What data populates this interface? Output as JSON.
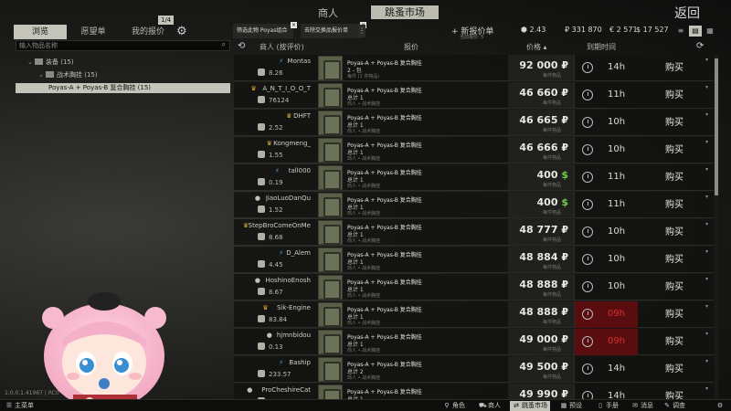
{
  "header": {
    "tab_trader": "商人",
    "tab_flea": "跳蚤市场",
    "back": "返回"
  },
  "left_panel": {
    "tabs": {
      "browse": "浏览",
      "wishlist": "愿望单",
      "my_offers": "我的报价",
      "offer_count": "1/4"
    },
    "search_placeholder": "输入物品名称",
    "tree": {
      "gear": "装备 (15)",
      "rig": "战术胸挂 (15)",
      "item": "Poyas-A + Poyas-B 复合胸挂 (15)"
    }
  },
  "filters": {
    "chip1": "筛选此物 Poyas组合",
    "chip2": "去除交换品报价单",
    "add_offer": "+ 新报价单",
    "add_offer_sub": "当前报价: 5"
  },
  "currencies": {
    "gp": "2.43",
    "rub": "331 870",
    "eur": "2 571",
    "usd": "17 527",
    "gp_symbol": "⬢",
    "rub_symbol": "₽",
    "eur_symbol": "€",
    "usd_symbol": "$"
  },
  "table": {
    "headers": {
      "merchant": "商人 (按评价)",
      "offer": "报价",
      "price": "价格 ▴",
      "expires": "到期时间"
    },
    "rows": [
      {
        "seller": "Montas",
        "badge": "lightning",
        "rating": "8.26",
        "title": "Poyas-A + Poyas-B 复合胸挂",
        "qty": "2 - 包",
        "sub": "每件 (1 件物品)",
        "price": "92 000",
        "currency": "₽",
        "price_sub": "每件物品",
        "expires": "14h",
        "urgent": false,
        "buy": "购买"
      },
      {
        "seller": "A_N_T_I_O_O_T",
        "badge": "crown",
        "rating": "76124",
        "title": "Poyas-A + Poyas-B 复合胸挂",
        "qty": "总计 1",
        "sub": "商人 • 战术胸挂",
        "price": "46 660",
        "currency": "₽",
        "price_sub": "每件物品",
        "expires": "11h",
        "urgent": false,
        "buy": "购买"
      },
      {
        "seller": "DHFT",
        "badge": "crown",
        "rating": "2.52",
        "title": "Poyas-A + Poyas-B 复合胸挂",
        "qty": "总计 1",
        "sub": "商人 • 战术胸挂",
        "price": "46 665",
        "currency": "₽",
        "price_sub": "每件物品",
        "expires": "10h",
        "urgent": false,
        "buy": "购买"
      },
      {
        "seller": "Kongmeng_",
        "badge": "crown",
        "rating": "1.55",
        "title": "Poyas-A + Poyas-B 复合胸挂",
        "qty": "总计 1",
        "sub": "商人 • 战术胸挂",
        "price": "46 666",
        "currency": "₽",
        "price_sub": "每件物品",
        "expires": "10h",
        "urgent": false,
        "buy": "购买"
      },
      {
        "seller": "tall000",
        "badge": "lightning",
        "rating": "0.19",
        "title": "Poyas-A + Poyas-B 复合胸挂",
        "qty": "总计 1",
        "sub": "商人 • 战术胸挂",
        "price": "400",
        "currency": "$",
        "price_sub": "每件物品",
        "expires": "11h",
        "urgent": false,
        "buy": "购买"
      },
      {
        "seller": "JiaoLuoDanQu",
        "badge": "person",
        "rating": "1.52",
        "title": "Poyas-A + Poyas-B 复合胸挂",
        "qty": "总计 1",
        "sub": "商人 • 战术胸挂",
        "price": "400",
        "currency": "$",
        "price_sub": "每件物品",
        "expires": "11h",
        "urgent": false,
        "buy": "购买"
      },
      {
        "seller": "StepBroComeOnMe",
        "badge": "crown",
        "rating": "8.68",
        "title": "Poyas-A + Poyas-B 复合胸挂",
        "qty": "总计 1",
        "sub": "商人 • 战术胸挂",
        "price": "48 777",
        "currency": "₽",
        "price_sub": "每件物品",
        "expires": "10h",
        "urgent": false,
        "buy": "购买"
      },
      {
        "seller": "D_Alem",
        "badge": "lightning",
        "rating": "4.45",
        "title": "Poyas-A + Poyas-B 复合胸挂",
        "qty": "总计 1",
        "sub": "商人 • 战术胸挂",
        "price": "48 884",
        "currency": "₽",
        "price_sub": "每件物品",
        "expires": "10h",
        "urgent": false,
        "buy": "购买"
      },
      {
        "seller": "HoshinoEnosh",
        "badge": "person",
        "rating": "8.67",
        "title": "Poyas-A + Poyas-B 复合胸挂",
        "qty": "总计 1",
        "sub": "商人 • 战术胸挂",
        "price": "48 888",
        "currency": "₽",
        "price_sub": "每件物品",
        "expires": "10h",
        "urgent": false,
        "buy": "购买"
      },
      {
        "seller": "Sik-Engine",
        "badge": "crown",
        "rating": "83.84",
        "title": "Poyas-A + Poyas-B 复合胸挂",
        "qty": "总计 1",
        "sub": "商人 • 战术胸挂",
        "price": "48 888",
        "currency": "₽",
        "price_sub": "每件物品",
        "expires": "09h",
        "urgent": true,
        "buy": "购买"
      },
      {
        "seller": "hjmnbidou",
        "badge": "person",
        "rating": "0.13",
        "title": "Poyas-A + Poyas-B 复合胸挂",
        "qty": "总计 1",
        "sub": "商人 • 战术胸挂",
        "price": "49 000",
        "currency": "₽",
        "price_sub": "每件物品",
        "expires": "09h",
        "urgent": true,
        "buy": "购买"
      },
      {
        "seller": "Baship",
        "badge": "lightning",
        "rating": "233.57",
        "title": "Poyas-A + Poyas-B 复合胸挂",
        "qty": "总计 2",
        "sub": "商人 • 战术胸挂",
        "price": "49 500",
        "currency": "₽",
        "price_sub": "每件物品",
        "expires": "14h",
        "urgent": false,
        "buy": "购买"
      },
      {
        "seller": "ProCheshireCat",
        "badge": "person",
        "rating": "5.05",
        "title": "Poyas-A + Poyas-B 复合胸挂",
        "qty": "总计 1",
        "sub": "商人 • 战术胸挂",
        "price": "49 990",
        "currency": "₽",
        "price_sub": "每件物品",
        "expires": "14h",
        "urgent": false,
        "buy": "购买"
      }
    ]
  },
  "version": "1.0.0.1.41967 | RC0",
  "bottom_bar": {
    "menu": "主菜单",
    "character": "角色",
    "traders": "商人",
    "flea": "跳蚤市场",
    "presets": "预设",
    "handbook": "手册",
    "messages": "消息",
    "survey": "调查"
  },
  "colors": {
    "accent": "#c4c4ba",
    "urgent_bg": "#5a0d0f",
    "urgent_text": "#d43030",
    "dollar": "#75c94a"
  }
}
